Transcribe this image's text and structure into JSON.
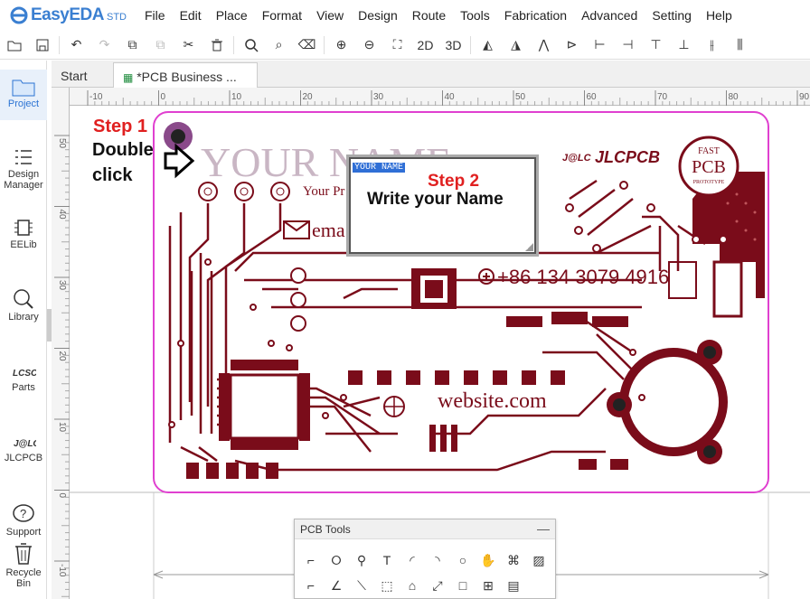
{
  "app": {
    "name": "EasyEDA",
    "edition": "STD"
  },
  "menu": [
    "File",
    "Edit",
    "Place",
    "Format",
    "View",
    "Design",
    "Route",
    "Tools",
    "Fabrication",
    "Advanced",
    "Setting",
    "Help"
  ],
  "toolbar": {
    "view_2d": "2D",
    "view_3d": "3D"
  },
  "sidebar": {
    "items": [
      {
        "label": "Project",
        "active": true
      },
      {
        "label": "Design Manager"
      },
      {
        "label": "EELib"
      },
      {
        "label": "Library"
      },
      {
        "label": "Parts"
      },
      {
        "label": "JLCPCB"
      },
      {
        "label": "Support"
      },
      {
        "label": "Recycle Bin"
      }
    ]
  },
  "tabs": [
    {
      "label": "Start",
      "active": false
    },
    {
      "label": "*PCB Business ...",
      "active": true
    }
  ],
  "rulers": {
    "top": [
      "-10",
      "0",
      "10",
      "20",
      "30",
      "40",
      "50",
      "60",
      "70",
      "80",
      "90"
    ],
    "left": [
      "50",
      "40",
      "30",
      "20",
      "10",
      "0",
      "-10"
    ]
  },
  "annotations": {
    "step1_title": "Step 1",
    "step1_line1": "Double",
    "step1_line2": "click",
    "step2_title": "Step 2",
    "step2_text": "Write your Name"
  },
  "edit_box": {
    "selected_text": "YOUR NAME"
  },
  "pcb": {
    "name_text": "YOUR NAME",
    "profession_text": "Your Pr",
    "email_text": "ema",
    "phone_text": "+86 134 3079 4916",
    "website_text": "website.com",
    "brand_text": "JLCPCB",
    "brand_prefix": "J@LC",
    "badge_line1": "FAST",
    "badge_line2": "PCB",
    "badge_line3": "PROTOTYPE"
  },
  "pcb_tools": {
    "title": "PCB Tools",
    "minimize": "—"
  },
  "colors": {
    "trace": "#7a0c1a",
    "board_outline": "#e040d0",
    "accent": "#2b73d3",
    "step_red": "#e02020"
  }
}
